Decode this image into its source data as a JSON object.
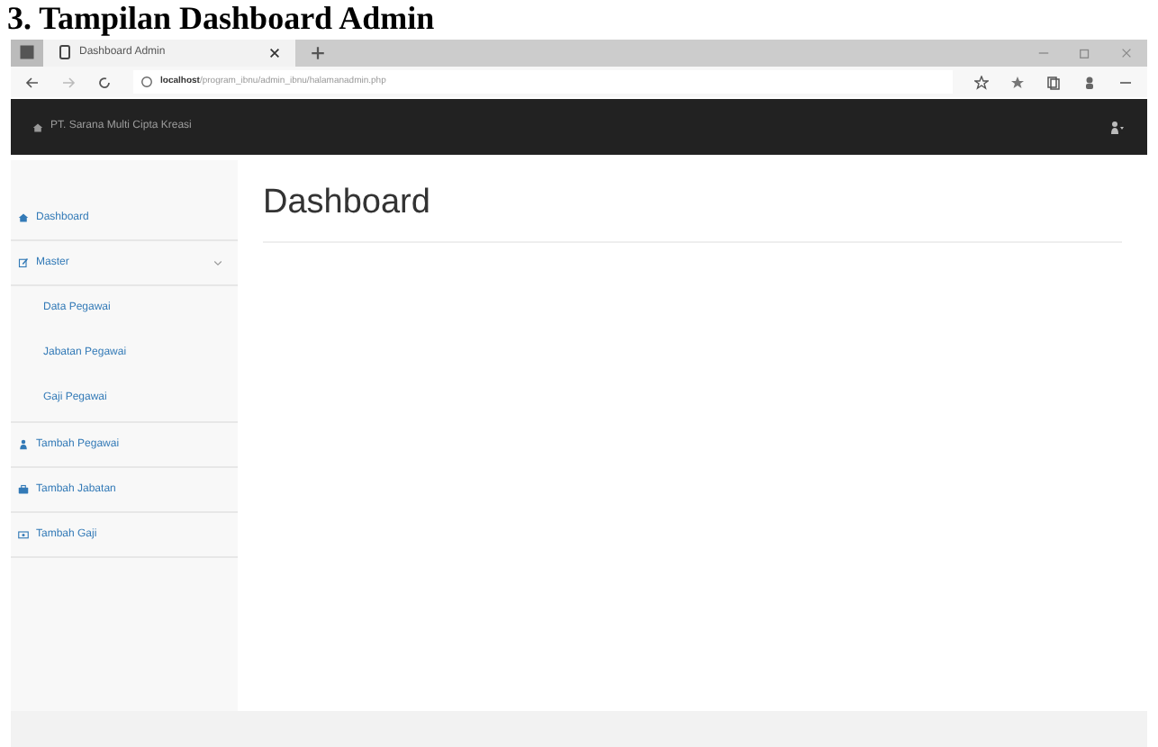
{
  "doc_heading": "3. Tampilan Dashboard Admin",
  "browser": {
    "tab_title": "Dashboard Admin",
    "url_host": "localhost",
    "url_path": "/program_ibnu/admin_ibnu/halamanadmin.php"
  },
  "navbar": {
    "brand": "PT. Sarana Multi Cipta Kreasi"
  },
  "sidebar": {
    "items": [
      {
        "label": "Dashboard"
      },
      {
        "label": "Master",
        "expanded": true,
        "children": [
          {
            "label": "Data Pegawai"
          },
          {
            "label": "Jabatan Pegawai"
          },
          {
            "label": "Gaji Pegawai"
          }
        ]
      },
      {
        "label": "Tambah Pegawai"
      },
      {
        "label": "Tambah Jabatan"
      },
      {
        "label": "Tambah Gaji"
      }
    ]
  },
  "page_title": "Dashboard"
}
